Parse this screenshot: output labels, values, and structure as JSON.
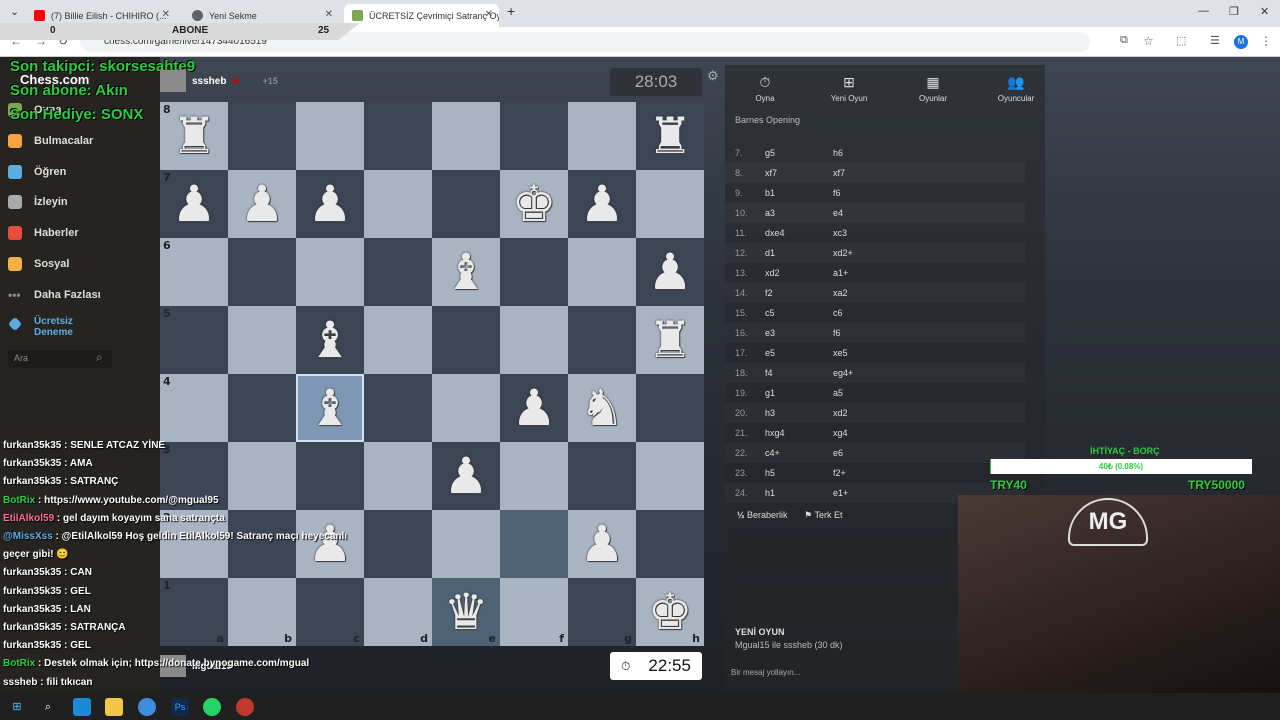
{
  "browser": {
    "tabs": [
      {
        "title": "(7) Billie Eilish - CHIHIRO (...",
        "color": "#ff0000"
      },
      {
        "title": "Yeni Sekme",
        "color": "#5f6368"
      },
      {
        "title": "ÜCRETSİZ Çevrimiçi Satranç Oy...",
        "color": "#7fa650"
      }
    ],
    "url": "chess.com/game/live/147344016519",
    "profile_initial": "M"
  },
  "stream": {
    "subs_left": "0",
    "subs_label": "ABONE",
    "subs_right": "25",
    "overlay_lines": [
      "Son takipci: skorsesahte9",
      "Son abone: Akın",
      "Son Hediye: SONX"
    ],
    "goal_title": "İHTİYAÇ - BORÇ",
    "goal_text": "40₺ (0.08%)",
    "goal_fraction": 0.0008,
    "goal_left": "TRY40",
    "goal_right": "TRY50000",
    "cam_logo": "MG"
  },
  "sidebar": {
    "logo": "Chess.com",
    "items": [
      {
        "label": "Oyna",
        "color": "#7fa650"
      },
      {
        "label": "Bulmacalar",
        "color": "#f7a440"
      },
      {
        "label": "Öğren",
        "color": "#5dade2"
      },
      {
        "label": "İzleyin",
        "color": "#aaaaaa"
      },
      {
        "label": "Haberler",
        "color": "#e74c3c"
      },
      {
        "label": "Sosyal",
        "color": "#f5b041"
      },
      {
        "label": "Daha Fazlası",
        "color": "#888888"
      }
    ],
    "trial_line1": "Ücretsiz",
    "trial_line2": "Deneme",
    "search_placeholder": "Ara"
  },
  "top_player": {
    "name": "sssheb",
    "score": "+15",
    "clock": "28:03"
  },
  "bottom_player": {
    "name": "Mgual15",
    "clock": "22:55"
  },
  "board": {
    "files": [
      "a",
      "b",
      "c",
      "d",
      "e",
      "f",
      "g",
      "h"
    ],
    "ranks": [
      "8",
      "7",
      "6",
      "5",
      "4",
      "3",
      "2",
      "1"
    ],
    "rows": [
      [
        "♜",
        "",
        "",
        "",
        "",
        "",
        "",
        "♜"
      ],
      [
        "♟",
        "♟",
        "♟",
        "",
        "",
        "♚",
        "♟",
        ""
      ],
      [
        "",
        "",
        "",
        "",
        "♝",
        "",
        "",
        "♟"
      ],
      [
        "",
        "",
        "♝",
        "",
        "",
        "",
        "",
        "♜"
      ],
      [
        "",
        "",
        "♝",
        "",
        "",
        "♟",
        "♞",
        ""
      ],
      [
        "",
        "",
        "",
        "",
        "♟",
        "",
        "",
        ""
      ],
      [
        "",
        "",
        "♟",
        "",
        "",
        "",
        "♟",
        ""
      ],
      [
        "",
        "",
        "",
        "",
        "♛",
        "",
        "",
        "♚"
      ]
    ],
    "selected": "c4",
    "highlighted": [
      "f2",
      "e1"
    ]
  },
  "panel": {
    "tabs": [
      "Oyna",
      "Yeni Oyun",
      "Oyunlar",
      "Oyuncular"
    ],
    "opening": "Barnes Opening",
    "moves": [
      {
        "n": "7.",
        "w": "g5",
        "b": "h6"
      },
      {
        "n": "8.",
        "w": "xf7",
        "b": "xf7"
      },
      {
        "n": "9.",
        "w": "b1",
        "b": "f6"
      },
      {
        "n": "10.",
        "w": "a3",
        "b": "e4"
      },
      {
        "n": "11.",
        "w": "dxe4",
        "b": "xc3"
      },
      {
        "n": "12.",
        "w": "d1",
        "b": "xd2+"
      },
      {
        "n": "13.",
        "w": "xd2",
        "b": "a1+"
      },
      {
        "n": "14.",
        "w": "f2",
        "b": "xa2"
      },
      {
        "n": "15.",
        "w": "c5",
        "b": "c6"
      },
      {
        "n": "16.",
        "w": "e3",
        "b": "f6"
      },
      {
        "n": "17.",
        "w": "e5",
        "b": "xe5"
      },
      {
        "n": "18.",
        "w": "f4",
        "b": "eg4+"
      },
      {
        "n": "19.",
        "w": "g1",
        "b": "a5"
      },
      {
        "n": "20.",
        "w": "h3",
        "b": "xd2"
      },
      {
        "n": "21.",
        "w": "hxg4",
        "b": "xg4"
      },
      {
        "n": "22.",
        "w": "c4+",
        "b": "e6"
      },
      {
        "n": "23.",
        "w": "h5",
        "b": "f2+"
      },
      {
        "n": "24.",
        "w": "h1",
        "b": "e1+"
      }
    ],
    "draw": "Beraberlik",
    "resign": "Terk Et",
    "new_game_title": "YENİ OYUN",
    "new_game_sub": "Mgual15 ile sssheb (30 dk)",
    "message_placeholder": "Bir mesaj yollayın..."
  },
  "chat": [
    {
      "user": "furkan35k35",
      "text": " : SENLE ATCAZ YİNE",
      "color": "#ffffff"
    },
    {
      "user": "furkan35k35",
      "text": " : AMA",
      "color": "#ffffff"
    },
    {
      "user": "furkan35k35",
      "text": " : SATRANÇ",
      "color": "#ffffff"
    },
    {
      "user": "BotRix",
      "text": " : https://www.youtube.com/@mgual95",
      "color": "#2ecc40"
    },
    {
      "user": "EtilAlkol59",
      "text": " : gel dayım koyayım sana satrançta",
      "color": "#ff6b9a"
    },
    {
      "user": "@MissXss",
      "text": " : @EtilAlkol59 Hoş geldin EtilAlkol59! Satranç maçı heyecanlı",
      "color": "#5dade2"
    },
    {
      "user": "",
      "text": "geçer gibi! 😊",
      "color": "#ffffff"
    },
    {
      "user": "furkan35k35",
      "text": " : CAN",
      "color": "#ffffff"
    },
    {
      "user": "furkan35k35",
      "text": " : GEL",
      "color": "#ffffff"
    },
    {
      "user": "furkan35k35",
      "text": " : LAN",
      "color": "#ffffff"
    },
    {
      "user": "furkan35k35",
      "text": " : SATRANÇA",
      "color": "#ffffff"
    },
    {
      "user": "furkan35k35",
      "text": " : GEL",
      "color": "#ffffff"
    },
    {
      "user": "BotRix",
      "text": " : Destek olmak için; https://donate.bynogame.com/mgual",
      "color": "#2ecc40"
    },
    {
      "user": "sssheb",
      "text": " : fili tıkıcan",
      "color": "#ffffff"
    }
  ]
}
